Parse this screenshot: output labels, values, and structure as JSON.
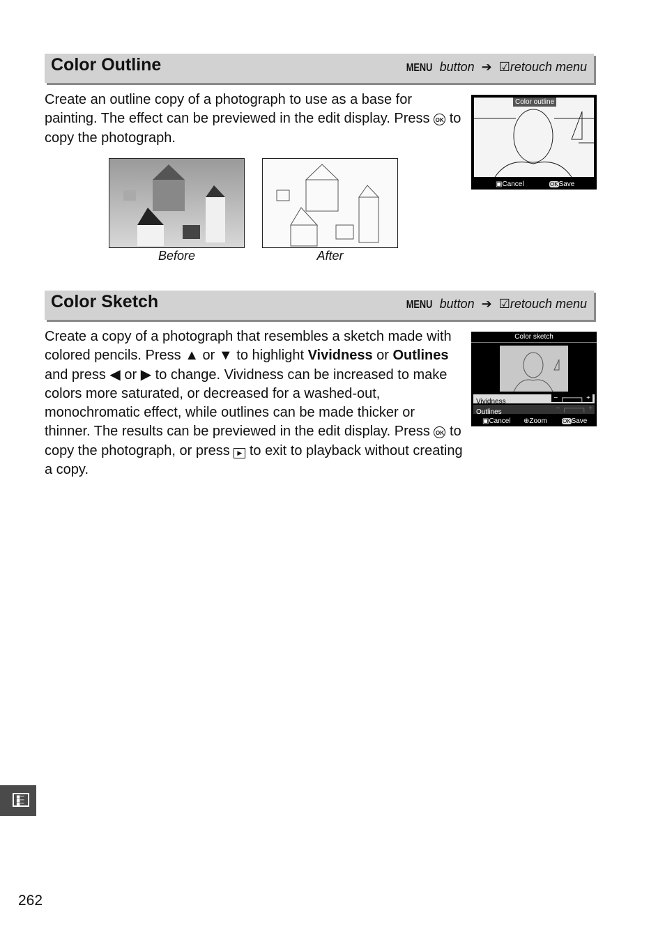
{
  "sections": [
    {
      "title": "Color Outline",
      "path": {
        "menu": "MENU",
        "button": "button",
        "arrow": "➔",
        "icon": "retouch-icon",
        "menu_name": "retouch menu"
      },
      "text": [
        "Create an outline copy of a photograph to use as a base for painting.  The effect can be previewed in the edit display.  Press ",
        "to copy the photograph."
      ],
      "ok_glyph": "OK",
      "captions": {
        "before": "Before",
        "after": "After"
      },
      "screen": {
        "title": "Color outline",
        "cancel": "Cancel",
        "save": "Save",
        "ok": "OK"
      }
    },
    {
      "title": "Color Sketch",
      "path": {
        "menu": "MENU",
        "button": "button",
        "arrow": "➔",
        "icon": "retouch-icon",
        "menu_name": "retouch menu"
      },
      "text": {
        "p1": "Create a copy of a photograph that resembles a sketch made with colored pencils.  Press ",
        "up": "▲",
        "or1": " or ",
        "down": "▼",
        "p2": " to highlight ",
        "vividness": "Vividness",
        "or2": " or ",
        "outlines": "Outlines",
        "p3": " and press ",
        "left": "◀",
        "or3": " or ",
        "right": "▶",
        "p4": " to change.  Vividness can be increased to make colors more saturated, or decreased for a washed-out, monochromatic effect, while outlines can be made thicker or thinner.  The results can be previewed in the edit display.  Press ",
        "p5": " to copy the photograph, or press ",
        "p6": " to exit to playback without creating a copy."
      },
      "screen": {
        "title": "Color sketch",
        "rows": [
          {
            "label": "Vividness",
            "level": 0.85,
            "selected": true
          },
          {
            "label": "Outlines",
            "level": 0.5,
            "selected": false
          }
        ],
        "cancel": "Cancel",
        "zoom": "Zoom",
        "save": "Save",
        "ok": "OK"
      }
    }
  ],
  "page_number": "262"
}
